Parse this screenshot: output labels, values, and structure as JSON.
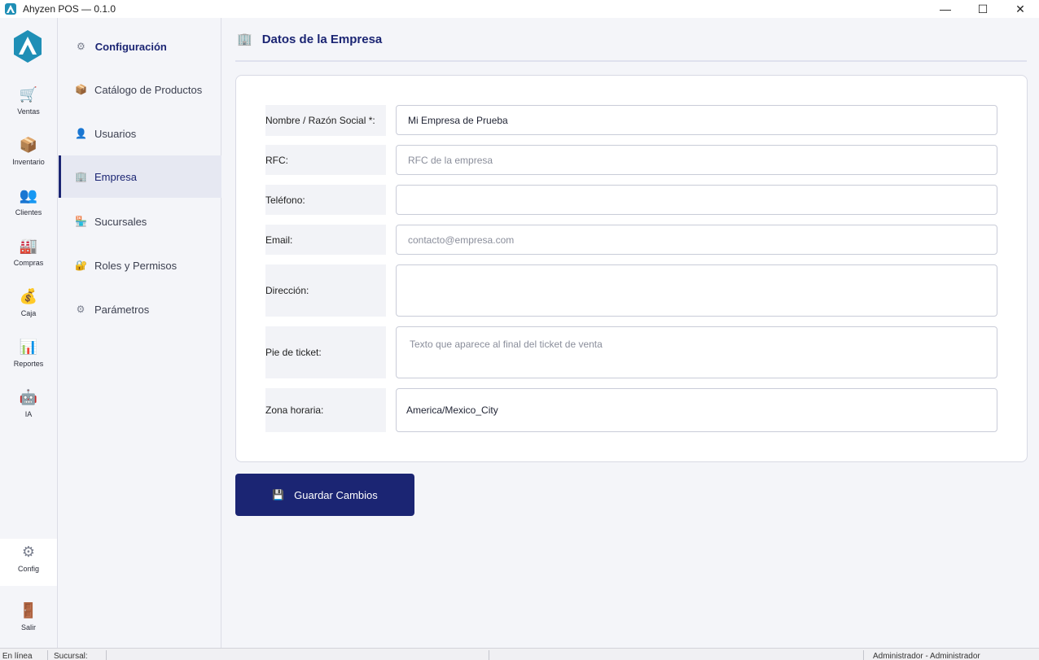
{
  "window": {
    "title": "Ahyzen POS — 0.1.0",
    "minimize_glyph": "—",
    "maximize_glyph": "☐",
    "close_glyph": "✕"
  },
  "rail": {
    "items": [
      {
        "label": "Ventas",
        "icon": "shopping-cart-icon",
        "glyph": "🛒"
      },
      {
        "label": "Inventario",
        "icon": "box-icon",
        "glyph": "📦"
      },
      {
        "label": "Clientes",
        "icon": "users-icon",
        "glyph": "👥"
      },
      {
        "label": "Compras",
        "icon": "factory-icon",
        "glyph": "🏭"
      },
      {
        "label": "Caja",
        "icon": "money-bag-icon",
        "glyph": "💰"
      },
      {
        "label": "Reportes",
        "icon": "chart-icon",
        "glyph": "📊"
      },
      {
        "label": "IA",
        "icon": "robot-icon",
        "glyph": "🤖"
      }
    ],
    "config": {
      "label": "Config",
      "icon": "gear-icon",
      "glyph": "⚙"
    },
    "exit": {
      "label": "Salir",
      "icon": "door-icon",
      "glyph": "🚪"
    }
  },
  "subnav": {
    "header": {
      "title": "Configuración",
      "icon": "gear-icon",
      "glyph": "⚙"
    },
    "items": [
      {
        "label": "Catálogo de Productos",
        "icon": "box-icon",
        "glyph": "📦"
      },
      {
        "label": "Usuarios",
        "icon": "user-icon",
        "glyph": "👤"
      },
      {
        "label": "Empresa",
        "icon": "office-building-icon",
        "glyph": "🏢"
      },
      {
        "label": "Sucursales",
        "icon": "store-icon",
        "glyph": "🏪"
      },
      {
        "label": "Roles y Permisos",
        "icon": "lock-icon",
        "glyph": "🔐"
      },
      {
        "label": "Parámetros",
        "icon": "gear-icon",
        "glyph": "⚙"
      }
    ],
    "active_index": 2
  },
  "page": {
    "title": "Datos de la Empresa",
    "title_glyph": "🏢"
  },
  "form": {
    "razon_social": {
      "label": "Nombre / Razón Social *:",
      "value": "Mi Empresa de Prueba"
    },
    "rfc": {
      "label": "RFC:",
      "placeholder": "RFC de la empresa"
    },
    "telefono": {
      "label": "Teléfono:",
      "value": ""
    },
    "email": {
      "label": "Email:",
      "placeholder": "contacto@empresa.com"
    },
    "direccion": {
      "label": "Dirección:",
      "value": ""
    },
    "pie_ticket": {
      "label": "Pie de ticket:",
      "placeholder": "Texto que aparece al final del ticket de venta"
    },
    "zona_horaria": {
      "label": "Zona horaria:",
      "value": "America/Mexico_City"
    }
  },
  "save_button": {
    "label": "Guardar Cambios",
    "glyph": "💾"
  },
  "statusbar": {
    "connection": "● En línea",
    "branch": "Sucursal:",
    "user": "Administrador - Administrador"
  },
  "colors": {
    "accent": "#1b2573",
    "background": "#f4f5f9",
    "logo": "#1f8fb6"
  }
}
